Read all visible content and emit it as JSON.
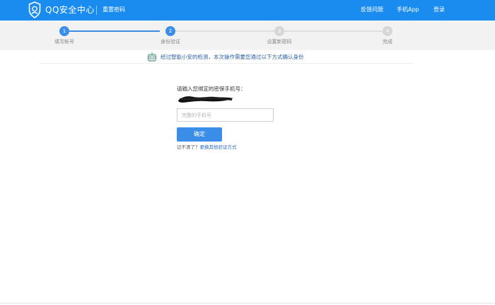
{
  "header": {
    "brand": "QQ安全中心",
    "subtitle": "重置密码",
    "nav": {
      "feedback": "反馈问题",
      "mobile_app": "手机App",
      "login": "登录"
    }
  },
  "steps": [
    {
      "num": "1",
      "label": "填写帐号",
      "state": "done"
    },
    {
      "num": "2",
      "label": "身份验证",
      "state": "current"
    },
    {
      "num": "3",
      "label": "设置新密码",
      "state": "pending"
    },
    {
      "num": "4",
      "label": "完成",
      "state": "pending"
    }
  ],
  "notice": {
    "icon": "robot-icon",
    "text": "经过智能小安的检测，本次操作需要您通过以下方式确认身份"
  },
  "form": {
    "prompt": "请输入您绑定的密保手机号：",
    "input_placeholder": "完整的手机号",
    "confirm_label": "确定",
    "forgot_text": "记不清了？",
    "forgot_link": "更换其他验证方式"
  },
  "colors": {
    "header": "#1a8cf0",
    "accent": "#3b8ee8",
    "progress_bg": "#f2f2f2"
  }
}
